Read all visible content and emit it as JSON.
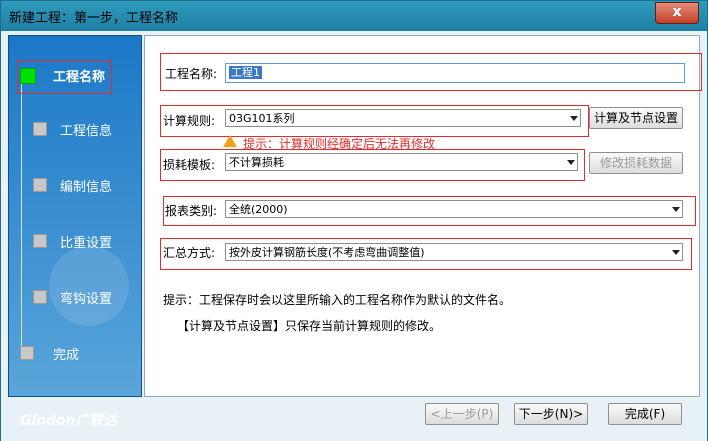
{
  "window": {
    "title": "新建工程：第一步，工程名称",
    "close": "x"
  },
  "sidebar": {
    "steps": [
      {
        "label": "工程名称",
        "active": true
      },
      {
        "label": "工程信息",
        "active": false
      },
      {
        "label": "编制信息",
        "active": false
      },
      {
        "label": "比重设置",
        "active": false
      },
      {
        "label": "弯钩设置",
        "active": false
      },
      {
        "label": "完成",
        "active": false
      }
    ],
    "logo": "Glodon广联达"
  },
  "form": {
    "project_name_label": "工程名称:",
    "project_name_value": "工程1",
    "calc_rule_label": "计算规则:",
    "calc_rule_value": "03G101系列",
    "calc_node_btn": "计算及节点设置",
    "warning": "提示：计算规则经确定后无法再修改",
    "loss_template_label": "损耗模板:",
    "loss_template_value": "不计算损耗",
    "modify_loss_btn": "修改损耗数据",
    "report_type_label": "报表类别:",
    "report_type_value": "全统(2000)",
    "summary_label": "汇总方式:",
    "summary_value": "按外皮计算钢筋长度(不考虑弯曲调整值)"
  },
  "hints": {
    "line1": "提示：工程保存时会以这里所输入的工程名称作为默认的文件名。",
    "line2": "【计算及节点设置】只保存当前计算规则的修改。"
  },
  "footer": {
    "prev": "<上一步(P)",
    "next": "下一步(N)>",
    "finish": "完成(F)"
  }
}
